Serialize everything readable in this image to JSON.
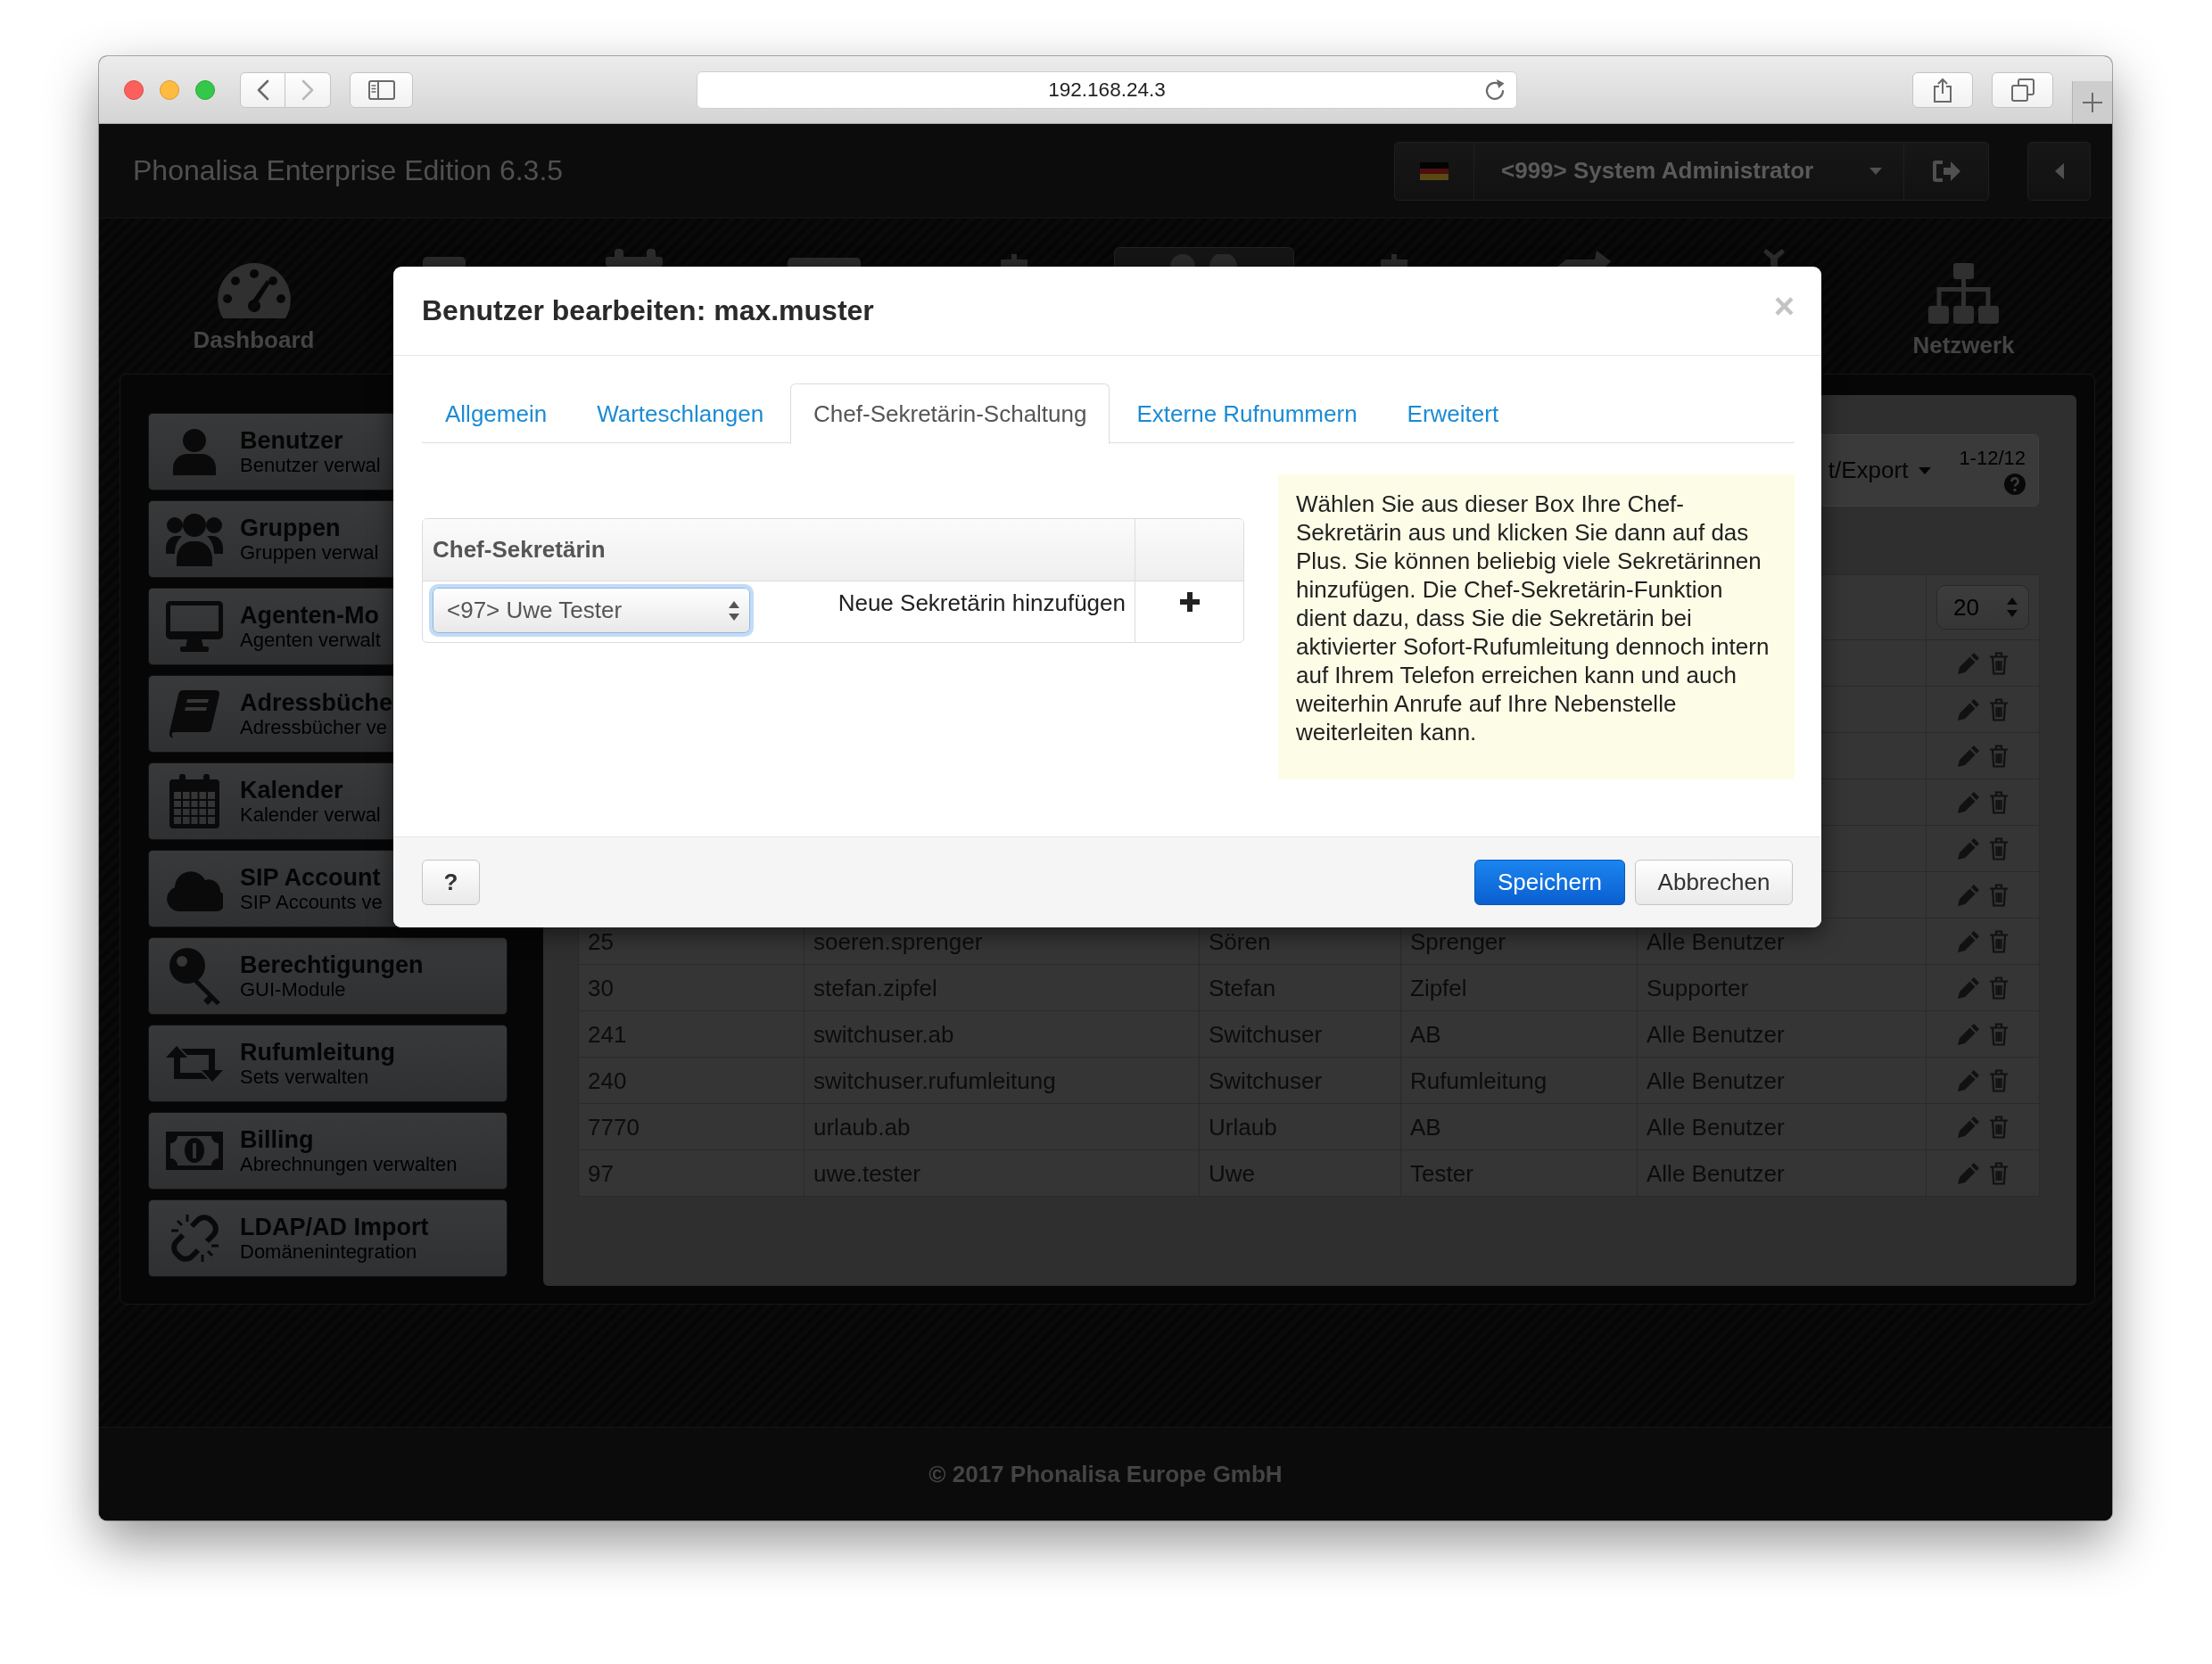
{
  "browser": {
    "url": "192.168.24.3"
  },
  "header": {
    "title": "Phonalisa Enterprise Edition 6.3.5",
    "user": "<999> System Administrator"
  },
  "nav": [
    {
      "kind": "dashboard",
      "label": "Dashboard",
      "selected": false
    },
    {
      "kind": "bar",
      "selected": false
    },
    {
      "kind": "knobs",
      "selected": false
    },
    {
      "kind": "screen",
      "selected": false
    },
    {
      "kind": "bump",
      "selected": false
    },
    {
      "kind": "heads",
      "selected": true
    },
    {
      "kind": "bump",
      "selected": false
    },
    {
      "kind": "arrow",
      "selected": false
    },
    {
      "kind": "cross",
      "selected": false
    },
    {
      "kind": "network",
      "label": "Netzwerk",
      "selected": false
    }
  ],
  "sidebar": [
    {
      "kind": "user",
      "title": "Benutzer",
      "subtitle": "Benutzer verwal"
    },
    {
      "kind": "group",
      "title": "Gruppen",
      "subtitle": "Gruppen verwal"
    },
    {
      "kind": "desktop",
      "title": "Agenten-Mo",
      "subtitle": "Agenten verwalt"
    },
    {
      "kind": "book",
      "title": "Adressbüche",
      "subtitle": "Adressbücher ve"
    },
    {
      "kind": "calendar",
      "title": "Kalender",
      "subtitle": "Kalender verwal"
    },
    {
      "kind": "cloud",
      "title": "SIP Account",
      "subtitle": "SIP Accounts ve"
    },
    {
      "kind": "key",
      "title": "Berechtigungen",
      "subtitle": "GUI-Module"
    },
    {
      "kind": "loop",
      "title": "Rufumleitung",
      "subtitle": "Sets verwalten"
    },
    {
      "kind": "money",
      "title": "Billing",
      "subtitle": "Abrechnungen verwalten"
    },
    {
      "kind": "chain",
      "title": "LDAP/AD Import",
      "subtitle": "Domänenintegration"
    }
  ],
  "toolbar": {
    "menu": "t/Export",
    "range": "1-12/12"
  },
  "table": {
    "page_size": "20",
    "rows": [
      {
        "actions": [
          {
            "kind": "edit"
          },
          {
            "kind": "delete"
          }
        ]
      },
      {
        "actions": [
          {
            "kind": "edit"
          },
          {
            "kind": "delete"
          }
        ]
      },
      {
        "actions": [
          {
            "kind": "edit"
          },
          {
            "kind": "delete"
          }
        ]
      },
      {
        "actions": [
          {
            "kind": "edit"
          },
          {
            "kind": "delete"
          }
        ]
      },
      {
        "actions": [
          {
            "kind": "edit"
          },
          {
            "kind": "delete"
          }
        ]
      },
      {
        "actions": [
          {
            "kind": "edit"
          },
          {
            "kind": "delete"
          }
        ]
      },
      {
        "cells": [
          "25",
          "soeren.sprenger",
          "Sören",
          "Sprenger",
          "Alle Benutzer"
        ],
        "actions": [
          {
            "kind": "edit"
          },
          {
            "kind": "delete"
          }
        ]
      },
      {
        "cells": [
          "30",
          "stefan.zipfel",
          "Stefan",
          "Zipfel",
          "Supporter"
        ],
        "actions": [
          {
            "kind": "edit"
          },
          {
            "kind": "delete"
          }
        ]
      },
      {
        "cells": [
          "241",
          "switchuser.ab",
          "Switchuser",
          "AB",
          "Alle Benutzer"
        ],
        "actions": [
          {
            "kind": "edit"
          },
          {
            "kind": "delete"
          }
        ]
      },
      {
        "cells": [
          "240",
          "switchuser.rufumleitung",
          "Switchuser",
          "Rufumleitung",
          "Alle Benutzer"
        ],
        "actions": [
          {
            "kind": "edit"
          },
          {
            "kind": "delete"
          }
        ]
      },
      {
        "cells": [
          "7770",
          "urlaub.ab",
          "Urlaub",
          "AB",
          "Alle Benutzer"
        ],
        "actions": [
          {
            "kind": "edit"
          },
          {
            "kind": "delete"
          }
        ]
      },
      {
        "cells": [
          "97",
          "uwe.tester",
          "Uwe",
          "Tester",
          "Alle Benutzer"
        ],
        "actions": [
          {
            "kind": "edit"
          },
          {
            "kind": "delete"
          }
        ]
      }
    ]
  },
  "dialog": {
    "title": "Benutzer bearbeiten: max.muster",
    "close": "×",
    "tabs": [
      {
        "label": "Allgemein",
        "selected": false
      },
      {
        "label": "Warteschlangen",
        "selected": false
      },
      {
        "label": "Chef-Sekretärin-Schaltung",
        "selected": true
      },
      {
        "label": "Externe Rufnummern",
        "selected": false
      },
      {
        "label": "Erweitert",
        "selected": false
      }
    ],
    "secretaries": {
      "header": "Chef-Sekretärin",
      "select": "<97> Uwe Tester",
      "add_label": "Neue Sekretärin hinzufügen"
    },
    "info": "Wählen Sie aus dieser Box Ihre Chef-Sekretärin aus und klicken Sie dann auf das Plus. Sie können beliebig viele Sekretärinnen hinzufügen. Die Chef-Sekretärin-Funktion dient dazu, dass Sie die Sekretärin bei aktivierter Sofort-Rufumleitung dennoch intern auf Ihrem Telefon erreichen kann und auch weiterhin Anrufe auf Ihre Nebenstelle weiterleiten kann.",
    "help": "?",
    "buttons": [
      {
        "kind": "primary",
        "label": "Speichern"
      },
      {
        "kind": "default",
        "label": "Abbrechen"
      }
    ]
  },
  "footer": {
    "copyright": "© 2017 Phonalisa Europe GmbH"
  }
}
